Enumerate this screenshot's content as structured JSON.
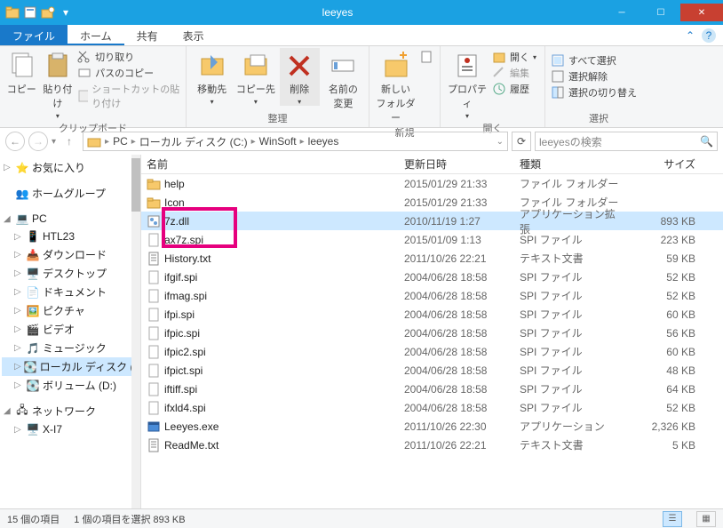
{
  "window": {
    "title": "leeyes"
  },
  "tabs": {
    "file": "ファイル",
    "home": "ホーム",
    "share": "共有",
    "view": "表示"
  },
  "ribbon": {
    "clipboard": {
      "copy": "コピー",
      "paste": "貼り付け",
      "cut": "切り取り",
      "copypath": "パスのコピー",
      "paste_shortcut": "ショートカットの貼り付け",
      "label": "クリップボード"
    },
    "organize": {
      "moveto": "移動先",
      "copyto": "コピー先",
      "delete": "削除",
      "rename": "名前の\n変更",
      "label": "整理"
    },
    "new": {
      "newfolder": "新しい\nフォルダー",
      "label": "新規"
    },
    "open": {
      "properties": "プロパティ",
      "open": "開く",
      "edit": "編集",
      "history": "履歴",
      "label": "開く"
    },
    "select": {
      "selectall": "すべて選択",
      "selectnone": "選択解除",
      "invert": "選択の切り替え",
      "label": "選択"
    }
  },
  "address": {
    "crumbs": [
      "PC",
      "ローカル ディスク (C:)",
      "WinSoft",
      "leeyes"
    ],
    "search_placeholder": "leeyesの検索"
  },
  "tree": {
    "fav": "お気に入り",
    "homegroup": "ホームグループ",
    "pc": "PC",
    "pc_children": [
      "HTL23",
      "ダウンロード",
      "デスクトップ",
      "ドキュメント",
      "ピクチャ",
      "ビデオ",
      "ミュージック",
      "ローカル ディスク (C",
      "ボリューム (D:)"
    ],
    "network": "ネットワーク",
    "net_children": [
      "X-I7"
    ]
  },
  "columns": {
    "name": "名前",
    "date": "更新日時",
    "type": "種類",
    "size": "サイズ"
  },
  "files": [
    {
      "name": "help",
      "date": "2015/01/29 21:33",
      "type": "ファイル フォルダー",
      "size": "",
      "icon": "folder",
      "sel": false
    },
    {
      "name": "Icon",
      "date": "2015/01/29 21:33",
      "type": "ファイル フォルダー",
      "size": "",
      "icon": "folder",
      "sel": false
    },
    {
      "name": "7z.dll",
      "date": "2010/11/19 1:27",
      "type": "アプリケーション拡張",
      "size": "893 KB",
      "icon": "dll",
      "sel": true
    },
    {
      "name": "ax7z.spi",
      "date": "2015/01/09 1:13",
      "type": "SPI ファイル",
      "size": "223 KB",
      "icon": "file",
      "sel": false
    },
    {
      "name": "History.txt",
      "date": "2011/10/26 22:21",
      "type": "テキスト文書",
      "size": "59 KB",
      "icon": "txt",
      "sel": false
    },
    {
      "name": "ifgif.spi",
      "date": "2004/06/28 18:58",
      "type": "SPI ファイル",
      "size": "52 KB",
      "icon": "file",
      "sel": false
    },
    {
      "name": "ifmag.spi",
      "date": "2004/06/28 18:58",
      "type": "SPI ファイル",
      "size": "52 KB",
      "icon": "file",
      "sel": false
    },
    {
      "name": "ifpi.spi",
      "date": "2004/06/28 18:58",
      "type": "SPI ファイル",
      "size": "60 KB",
      "icon": "file",
      "sel": false
    },
    {
      "name": "ifpic.spi",
      "date": "2004/06/28 18:58",
      "type": "SPI ファイル",
      "size": "56 KB",
      "icon": "file",
      "sel": false
    },
    {
      "name": "ifpic2.spi",
      "date": "2004/06/28 18:58",
      "type": "SPI ファイル",
      "size": "60 KB",
      "icon": "file",
      "sel": false
    },
    {
      "name": "ifpict.spi",
      "date": "2004/06/28 18:58",
      "type": "SPI ファイル",
      "size": "48 KB",
      "icon": "file",
      "sel": false
    },
    {
      "name": "iftiff.spi",
      "date": "2004/06/28 18:58",
      "type": "SPI ファイル",
      "size": "64 KB",
      "icon": "file",
      "sel": false
    },
    {
      "name": "ifxld4.spi",
      "date": "2004/06/28 18:58",
      "type": "SPI ファイル",
      "size": "52 KB",
      "icon": "file",
      "sel": false
    },
    {
      "name": "Leeyes.exe",
      "date": "2011/10/26 22:30",
      "type": "アプリケーション",
      "size": "2,326 KB",
      "icon": "exe",
      "sel": false
    },
    {
      "name": "ReadMe.txt",
      "date": "2011/10/26 22:21",
      "type": "テキスト文書",
      "size": "5 KB",
      "icon": "txt",
      "sel": false
    }
  ],
  "status": {
    "count": "15 個の項目",
    "selected": "1 個の項目を選択 893 KB"
  }
}
